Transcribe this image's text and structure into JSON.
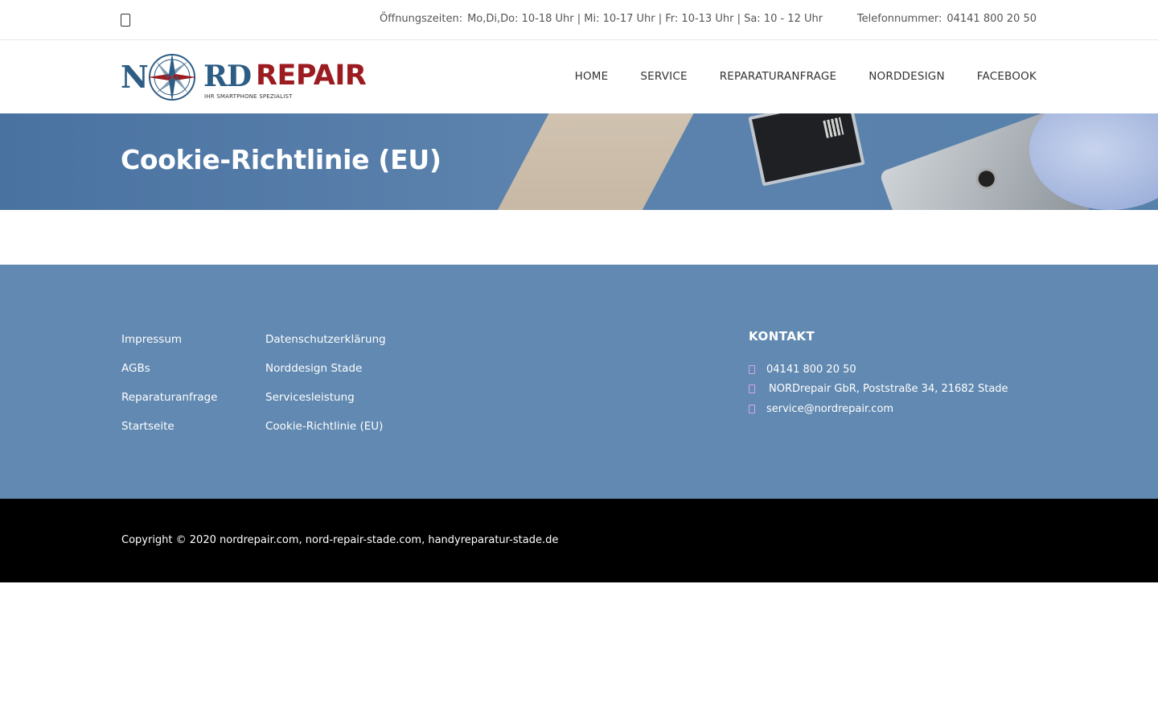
{
  "topbar": {
    "hours_label": "Öffnungszeiten:",
    "hours_value": "Mo,Di,Do: 10-18 Uhr | Mi: 10-17 Uhr | Fr: 10-13 Uhr | Sa: 10 - 12 Uhr",
    "phone_label": "Telefonnummer:",
    "phone_value": "04141 800 20 50"
  },
  "logo": {
    "n": "N",
    "rd": "RD",
    "repair": "REPAIR",
    "tagline": "IHR SMARTPHONE SPEZIALIST"
  },
  "nav": {
    "items": [
      "HOME",
      "SERVICE",
      "REPARATURANFRAGE",
      "NORDDESIGN",
      "FACEBOOK"
    ]
  },
  "hero": {
    "title": "Cookie-Richtlinie (EU)"
  },
  "footer": {
    "col1": [
      "Impressum",
      "AGBs",
      "Reparaturanfrage",
      "Startseite"
    ],
    "col2": [
      "Datenschutzerklärung",
      "Norddesign Stade",
      "Servicesleistung",
      "Cookie-Richtlinie (EU)"
    ],
    "kontakt": {
      "heading": "KONTAKT",
      "phone": "04141 800 20 50",
      "address": "NORDrepair GbR, Poststraße 34, 21682 Stade",
      "email": "service@nordrepair.com"
    }
  },
  "copyright": "Copyright © 2020 nordrepair.com, nord-repair-stade.com, handyreparatur-stade.de",
  "colors": {
    "brand_blue": "#2d5d84",
    "brand_red": "#9b1b20",
    "footer_bg": "#6189b1",
    "hero_bg": "#4f78a4",
    "icon_accent": "#d7a6e6"
  }
}
